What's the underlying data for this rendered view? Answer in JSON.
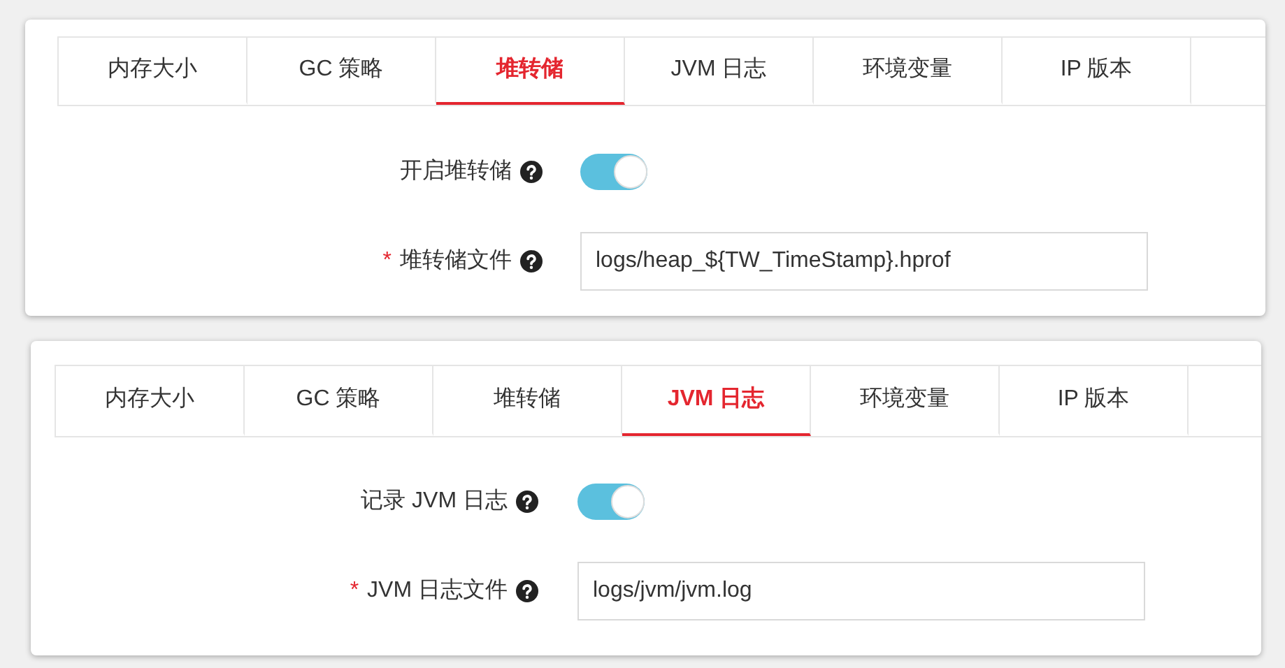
{
  "panels": [
    {
      "tabs": [
        {
          "label": "内存大小",
          "selected": false
        },
        {
          "label": "GC 策略",
          "selected": false
        },
        {
          "label": "堆转储",
          "selected": true
        },
        {
          "label": "JVM 日志",
          "selected": false
        },
        {
          "label": "环境变量",
          "selected": false
        },
        {
          "label": "IP 版本",
          "selected": false
        }
      ],
      "fields": [
        {
          "kind": "toggle",
          "label": "开启堆转储",
          "on": true
        },
        {
          "kind": "text",
          "required_mark": "*",
          "label": "堆转储文件",
          "value": "logs/heap_${TW_TimeStamp}.hprof"
        }
      ]
    },
    {
      "tabs": [
        {
          "label": "内存大小",
          "selected": false
        },
        {
          "label": "GC 策略",
          "selected": false
        },
        {
          "label": "堆转储",
          "selected": false
        },
        {
          "label": "JVM 日志",
          "selected": true
        },
        {
          "label": "环境变量",
          "selected": false
        },
        {
          "label": "IP 版本",
          "selected": false
        }
      ],
      "fields": [
        {
          "kind": "toggle",
          "label": "记录 JVM 日志",
          "on": true
        },
        {
          "kind": "text",
          "required_mark": "*",
          "label": "JVM 日志文件",
          "value": "logs/jvm/jvm.log"
        }
      ]
    }
  ]
}
